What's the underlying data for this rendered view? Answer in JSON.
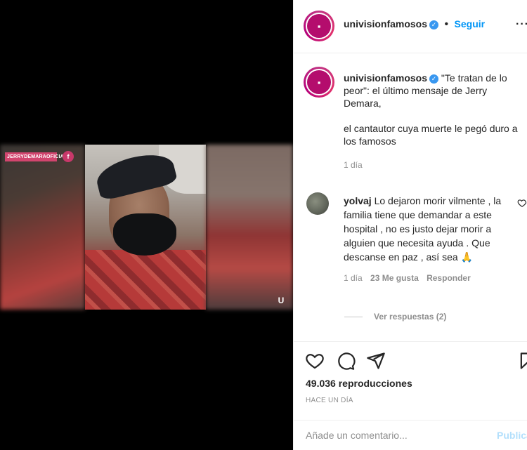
{
  "post": {
    "account": "univisionfamosos",
    "follow_label": "Seguir",
    "more_label": "···",
    "avatar_glyph": "⬤",
    "video_tag": "JERRYDEMARAOFICIAL",
    "video_tag_badge": "f",
    "watermark_glyph": "U"
  },
  "caption": {
    "username": "univisionfamosos",
    "text_1": "\"Te tratan de lo peor\": el último mensaje de Jerry Demara,",
    "text_2": "el cantautor cuya muerte le pegó duro a los famosos",
    "time": "1 día"
  },
  "comment": {
    "username": "yolvaj",
    "text": "Lo dejaron morir vilmente , la familia tiene que demandar a este hospital , no es justo dejar morir a alguien que necesita ayuda . Que descanse en paz , así sea 🙏",
    "time": "1 día",
    "likes": "23 Me gusta",
    "reply_label": "Responder",
    "view_replies": "Ver respuestas (2)"
  },
  "actions": {
    "views": "49.036 reproducciones",
    "time_ago": "HACE UN DÍA",
    "comment_placeholder": "Añade un comentario...",
    "publish_label": "Publicar"
  },
  "colors": {
    "accent": "#0095f6",
    "verified": "#3897f0",
    "brand": "#b40d6d"
  }
}
